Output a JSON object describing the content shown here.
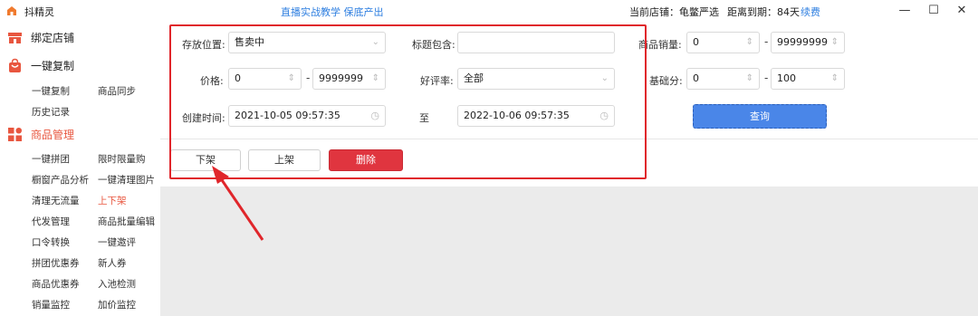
{
  "app": {
    "title": "抖精灵"
  },
  "header": {
    "promo": "直播实战教学 保底产出",
    "store": "当前店铺：龟鳖严选",
    "expire": "距离到期：84天",
    "renew": "续费",
    "minimize": "—",
    "maximize": "☐",
    "close": "✕"
  },
  "sidebar": {
    "bind_store": "绑定店铺",
    "one_click_copy": "一键复制",
    "copy_items": [
      "一键复制",
      "商品同步",
      "历史记录"
    ],
    "goods_manage": "商品管理",
    "goods_items": [
      "一键拼团",
      "限时限量购",
      "橱窗产品分析",
      "一键清理图片",
      "清理无流量",
      "上下架",
      "代发管理",
      "商品批量编辑",
      "口令转换",
      "一键邀评",
      "拼团优惠券",
      "新人券",
      "商品优惠券",
      "入池检测",
      "销量监控",
      "加价监控"
    ],
    "active_item": "上下架"
  },
  "filters": {
    "storage_label": "存放位置:",
    "storage_value": "售卖中",
    "title_label": "标题包含:",
    "title_value": "",
    "sales_label": "商品销量:",
    "sales_min": "0",
    "sales_max": "99999999",
    "price_label": "价格:",
    "price_min": "0",
    "price_max": "9999999",
    "rating_label": "好评率:",
    "rating_value": "全部",
    "base_label": "基础分:",
    "base_min": "0",
    "base_max": "100",
    "created_label": "创建时间:",
    "created_from": "2021-10-05 09:57:35",
    "to_label": "至",
    "created_to": "2022-10-06 09:57:35",
    "dash": "-"
  },
  "actions": {
    "query": "查询",
    "take_down": "下架",
    "put_up": "上架",
    "delete": "删除"
  },
  "colors": {
    "accent": "#e8563f",
    "primary": "#4a86e8",
    "danger": "#e0353f",
    "highlight": "#e0262b"
  }
}
